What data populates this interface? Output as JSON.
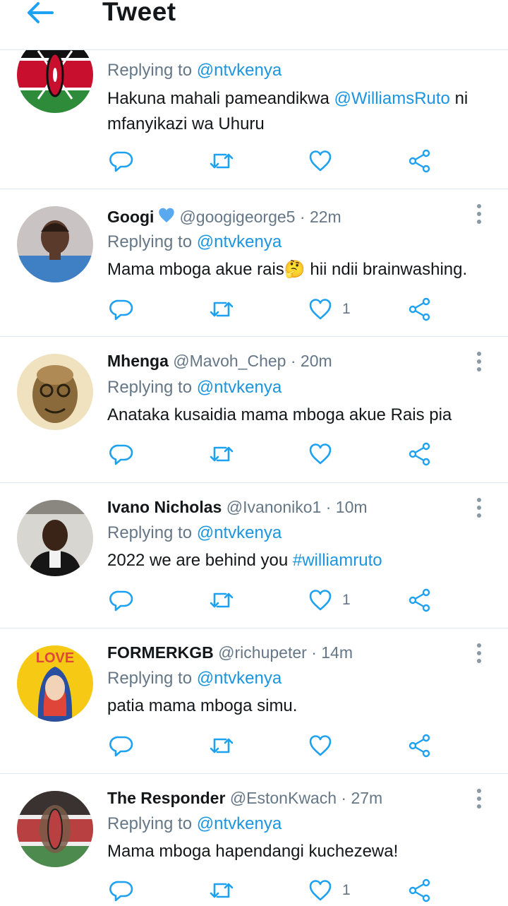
{
  "header": {
    "title": "Tweet"
  },
  "tweets": [
    {
      "name": "",
      "handle": "",
      "time": "",
      "replying_label": "Replying to",
      "replying_to": "@ntvkenya",
      "text_parts": [
        "Hakuna mahali pameandikwa ",
        "@WilliamsRuto",
        " ni mfanyikazi wa Uhuru"
      ],
      "like_count": ""
    },
    {
      "name": "Googi",
      "handle": "@googigeorge5",
      "time": "22m",
      "replying_label": "Replying to",
      "replying_to": "@ntvkenya",
      "text_parts": [
        "Mama mboga akue rais",
        "🤔",
        " hii ndii brainwashing."
      ],
      "like_count": "1"
    },
    {
      "name": "Mhenga",
      "handle": "@Mavoh_Chep",
      "time": "20m",
      "replying_label": "Replying to",
      "replying_to": "@ntvkenya",
      "text_parts": [
        "Anataka kusaidia mama mboga akue Rais pia"
      ],
      "like_count": ""
    },
    {
      "name": "Ivano Nicholas",
      "handle": "@Ivanoniko1",
      "time": "10m",
      "replying_label": "Replying to",
      "replying_to": "@ntvkenya",
      "text_parts": [
        "2022 we are behind you ",
        "#williamruto"
      ],
      "like_count": "1"
    },
    {
      "name": "FORMERKGB",
      "handle": "@richupeter",
      "time": "14m",
      "replying_label": "Replying to",
      "replying_to": "@ntvkenya",
      "text_parts": [
        "patia mama mboga simu."
      ],
      "like_count": ""
    },
    {
      "name": "The Responder",
      "handle": "@EstonKwach",
      "time": "27m",
      "replying_label": "Replying to",
      "replying_to": "@ntvkenya",
      "text_parts": [
        "Mama mboga hapendangi kuchezewa!"
      ],
      "like_count": "1"
    }
  ],
  "dot": "·",
  "colors": {
    "accent": "#1b95e0",
    "text": "#14171a",
    "muted": "#657786",
    "divider": "#e1e8ed"
  },
  "icons": [
    "back-arrow-icon",
    "more-vertical-icon",
    "reply-icon",
    "retweet-icon",
    "like-icon",
    "share-icon",
    "verified-heart-icon"
  ]
}
